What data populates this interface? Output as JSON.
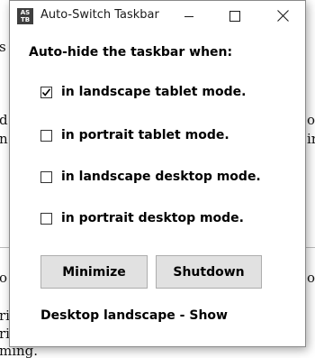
{
  "background_doc": {
    "fragments": [
      "s",
      "d",
      "n",
      "o",
      "ri",
      "ri",
      "ming.",
      "or",
      "ir",
      "o"
    ]
  },
  "window": {
    "title": "Auto-Switch Taskbar",
    "icon_letters": [
      "AS",
      "TB"
    ],
    "controls": {
      "minimize_icon": "minimize-icon",
      "maximize_icon": "maximize-icon",
      "close_icon": "close-icon"
    }
  },
  "content": {
    "heading": "Auto-hide the taskbar when:",
    "options": [
      {
        "label": "in landscape tablet mode.",
        "checked": true
      },
      {
        "label": "in portrait tablet mode.",
        "checked": false
      },
      {
        "label": "in landscape desktop mode.",
        "checked": false
      },
      {
        "label": "in portrait desktop mode.",
        "checked": false
      }
    ],
    "buttons": {
      "minimize": "Minimize",
      "shutdown": "Shutdown"
    },
    "status": "Desktop landscape - Show"
  },
  "colors": {
    "button_face": "#e1e1e1",
    "button_border": "#adadad",
    "window_border": "#8a8a8a"
  }
}
